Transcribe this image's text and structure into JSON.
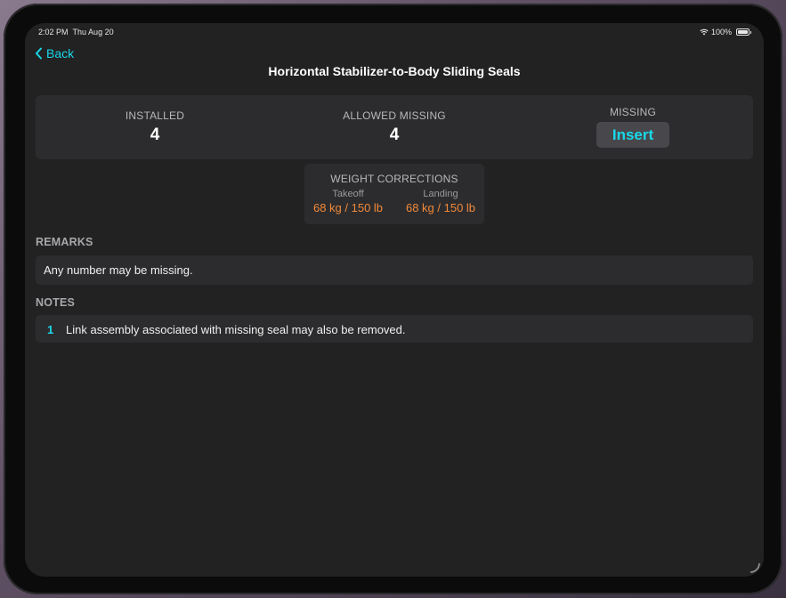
{
  "status_bar": {
    "time": "2:02 PM",
    "date": "Thu Aug 20",
    "battery": "100%"
  },
  "nav": {
    "back_label": "Back",
    "title": "Horizontal Stabilizer-to-Body Sliding Seals"
  },
  "stats": {
    "installed_label": "INSTALLED",
    "installed_value": "4",
    "allowed_missing_label": "ALLOWED MISSING",
    "allowed_missing_value": "4",
    "missing_label": "MISSING",
    "missing_button": "Insert"
  },
  "weight_corrections": {
    "title": "WEIGHT CORRECTIONS",
    "takeoff_label": "Takeoff",
    "takeoff_value": "68 kg / 150 lb",
    "landing_label": "Landing",
    "landing_value": "68 kg / 150 lb"
  },
  "remarks": {
    "header": "REMARKS",
    "text": "Any number may be missing."
  },
  "notes": {
    "header": "NOTES",
    "items": [
      {
        "number": "1",
        "text": "Link assembly associated with missing seal may also be removed."
      }
    ]
  },
  "colors": {
    "accent": "#19d8e8",
    "weight_value": "#f2893a",
    "background": "#222223",
    "card": "#2c2c2e"
  }
}
